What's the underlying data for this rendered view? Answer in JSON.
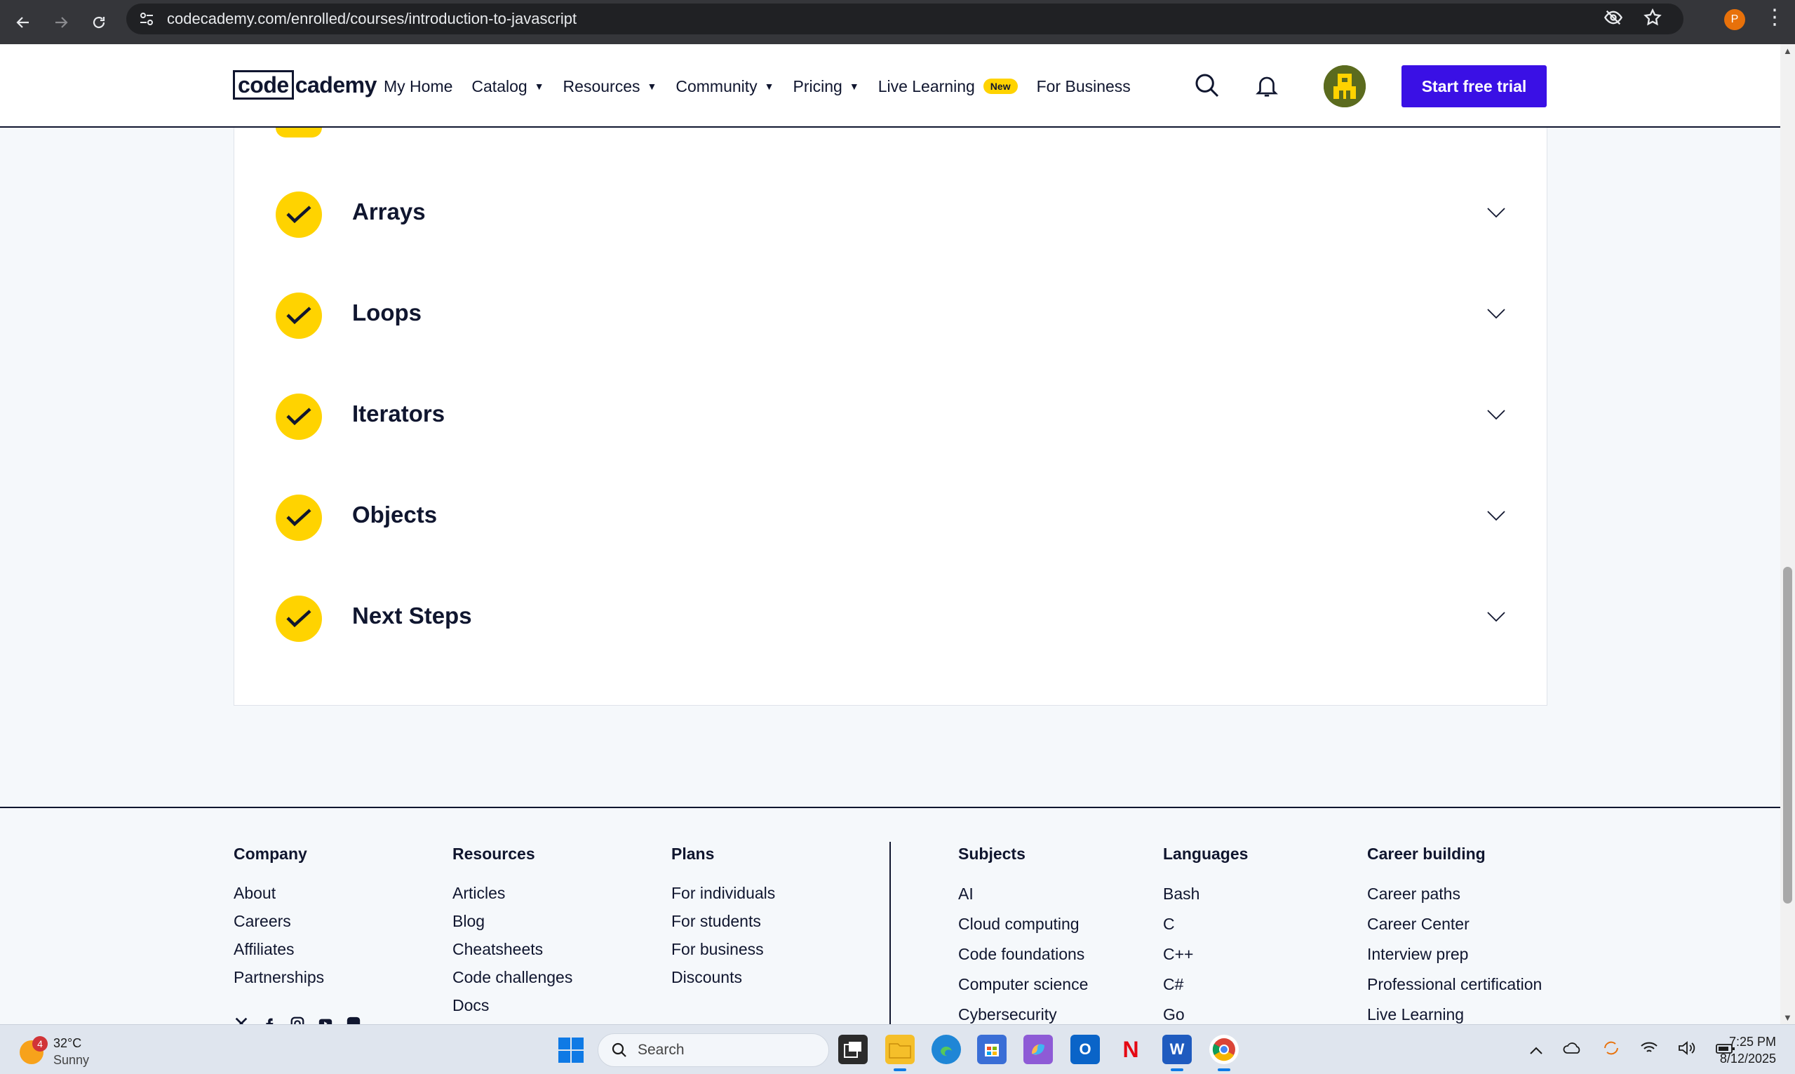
{
  "browser": {
    "url": "codecademy.com/enrolled/courses/introduction-to-javascript",
    "profile_initial": "P"
  },
  "header": {
    "logo_box": "code",
    "logo_rest": "cademy",
    "nav": [
      {
        "label": "My Home",
        "caret": false
      },
      {
        "label": "Catalog",
        "caret": true
      },
      {
        "label": "Resources",
        "caret": true
      },
      {
        "label": "Community",
        "caret": true
      },
      {
        "label": "Pricing",
        "caret": true
      },
      {
        "label": "Live Learning",
        "caret": false
      },
      {
        "label": "For Business",
        "caret": false
      }
    ],
    "new_badge": "New",
    "cta_label": "Start free trial"
  },
  "modules": [
    {
      "title": "Arrays"
    },
    {
      "title": "Loops"
    },
    {
      "title": "Iterators"
    },
    {
      "title": "Objects"
    },
    {
      "title": "Next Steps"
    }
  ],
  "footer": {
    "company": {
      "heading": "Company",
      "links": [
        "About",
        "Careers",
        "Affiliates",
        "Partnerships"
      ]
    },
    "resources": {
      "heading": "Resources",
      "links": [
        "Articles",
        "Blog",
        "Cheatsheets",
        "Code challenges",
        "Docs"
      ]
    },
    "plans": {
      "heading": "Plans",
      "links": [
        "For individuals",
        "For students",
        "For business",
        "Discounts"
      ]
    },
    "subjects": {
      "heading": "Subjects",
      "links": [
        "AI",
        "Cloud computing",
        "Code foundations",
        "Computer science",
        "Cybersecurity"
      ]
    },
    "languages": {
      "heading": "Languages",
      "links": [
        "Bash",
        "C",
        "C++",
        "C#",
        "Go"
      ]
    },
    "career": {
      "heading": "Career building",
      "links": [
        "Career paths",
        "Career Center",
        "Interview prep",
        "Professional certification",
        "Live Learning"
      ]
    }
  },
  "taskbar": {
    "weather_temp": "32°C",
    "weather_cond": "Sunny",
    "weather_badge": "4",
    "search_placeholder": "Search",
    "time": "7:25 PM",
    "date": "8/12/2025"
  },
  "colors": {
    "brand_purple": "#3a10e5",
    "check_yellow": "#ffd300",
    "navy": "#10162f"
  }
}
